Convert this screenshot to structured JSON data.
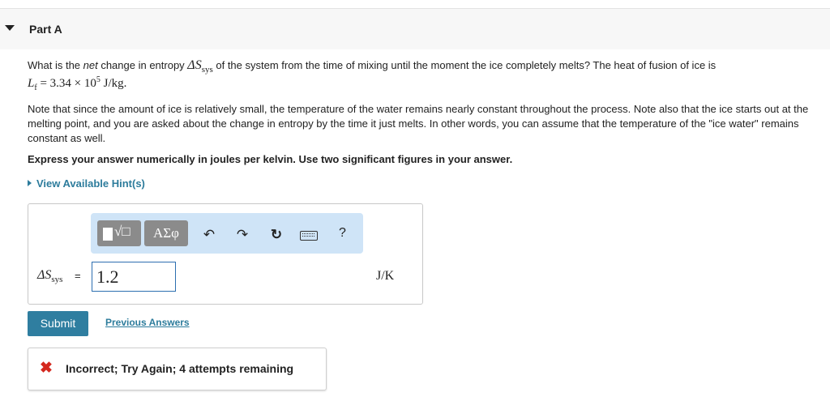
{
  "part": {
    "title": "Part A"
  },
  "question": {
    "intro": "What is the ",
    "emphasis": "net",
    "mid": " change in entropy ",
    "symbol_main": "ΔS",
    "symbol_sub": "sys",
    "after_symbol": " of the system from the time of mixing until the moment the ice completely melts? The heat of fusion of ice is",
    "line2_var": "L",
    "line2_sub": "f",
    "line2_eq": " = 3.34 × 10",
    "line2_exp": "5",
    "line2_units": " J/kg."
  },
  "note": "Note that since the amount of ice is relatively small, the temperature of the water remains nearly constant throughout the process. Note also that the ice starts out at the melting point, and you are asked about the change in entropy by the time it just melts. In other words, you can assume that the temperature of the \"ice water\" remains constant as well.",
  "instruction": "Express your answer numerically in joules per kelvin. Use two significant figures in your answer.",
  "hints_link": "View Available Hint(s)",
  "toolbar": {
    "templates_glyph": "√□",
    "greek_glyph": "ΑΣφ",
    "undo_glyph": "↶",
    "redo_glyph": "↷",
    "reset_glyph": "↻",
    "help_glyph": "?",
    "icons": [
      "templates-icon",
      "greek-symbols-icon",
      "undo-icon",
      "redo-icon",
      "reset-icon",
      "keyboard-icon",
      "help-icon"
    ]
  },
  "answer": {
    "label_main": "ΔS",
    "label_sub": "sys",
    "equals": "=",
    "value": "1.2",
    "units": "J/K"
  },
  "actions": {
    "submit_label": "Submit",
    "previous_answers_label": "Previous Answers"
  },
  "feedback": {
    "icon": "✖",
    "text": "Incorrect; Try Again; 4 attempts remaining",
    "color": "#d4281e"
  },
  "colors": {
    "accent": "#2d7c9c",
    "submit_bg": "#2f7ea0",
    "toolbar_bg": "#cfe4f7",
    "error": "#d4281e"
  }
}
